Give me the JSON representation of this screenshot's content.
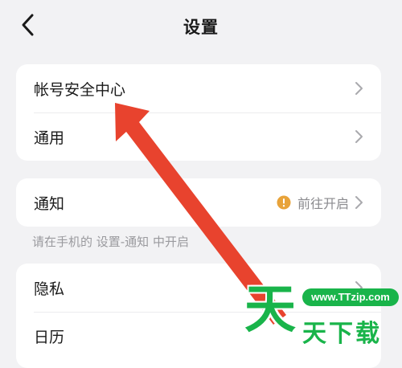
{
  "header": {
    "title": "设置",
    "back_icon": "chevron-left-icon"
  },
  "groups": [
    {
      "items": [
        {
          "label": "帐号安全中心"
        },
        {
          "label": "通用"
        }
      ]
    },
    {
      "items": [
        {
          "label": "通知",
          "value": "前往开启",
          "status_icon": "warning-icon"
        }
      ]
    },
    {
      "items": [
        {
          "label": "隐私"
        },
        {
          "label": "日历"
        }
      ]
    }
  ],
  "notice_hint": "请在手机的 设置-通知 中开启",
  "annotation": {
    "arrow_color": "#e8432e"
  },
  "watermark": {
    "url": "www.TTzip.com",
    "char_big": "天",
    "chars_rest": "天下载",
    "color": "#19b44a"
  },
  "colors": {
    "background": "#f2f2f4",
    "card": "#ffffff",
    "warning": "#e8a33a"
  }
}
